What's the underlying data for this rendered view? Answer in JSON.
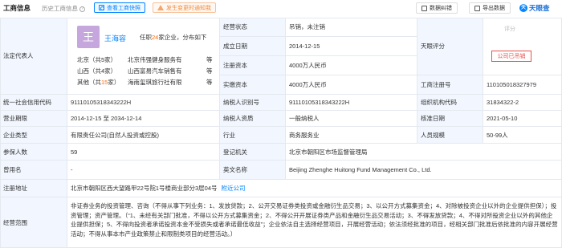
{
  "header": {
    "tab_main": "工商信息",
    "tab_history": "历史工商信息",
    "history_help": "?",
    "snapshot_btn": "查看工商快照",
    "alert_btn": "发生变更时通知我",
    "correct_btn": "数据纠错",
    "export_btn": "导出数据",
    "logo_mark": "天",
    "logo_text": "天眼查"
  },
  "legal_rep": {
    "label": "法定代表人",
    "avatar_char": "王",
    "name": "王海容",
    "note_prefix": "任职",
    "note_count": "24",
    "note_suffix": "家企业，分布如下",
    "rows": [
      {
        "region": "北京",
        "count_text": "（共5家）",
        "company": "北京伟强健身服务有",
        "etc": "等"
      },
      {
        "region": "山西",
        "count_text": "（共4家）",
        "company": "山西富易汽车销售有",
        "etc": "等"
      },
      {
        "region": "其他",
        "count_text_prefix": "（共",
        "count": "15",
        "count_text_suffix": "家）",
        "company": "海南玺琪旅行社有限",
        "etc": "等"
      }
    ]
  },
  "fields": {
    "status_label": "经营状态",
    "status_value": "吊销，未注销",
    "founded_label": "成立日期",
    "founded_value": "2014-12-15",
    "reg_capital_label": "注册资本",
    "reg_capital_value": "4000万人民币",
    "paid_capital_label": "实缴资本",
    "paid_capital_value": "4000万人民币",
    "rating_label": "天眼评分",
    "rating_top": "评分",
    "rating_box": "公司已吊销",
    "reg_no_label": "工商注册号",
    "reg_no_value": "110105018327979",
    "credit_code_label": "统一社会信用代码",
    "credit_code_value": "91110105318343222H",
    "taxpayer_id_label": "纳税人识别号",
    "taxpayer_id_value": "91110105318343222H",
    "org_code_label": "组织机构代码",
    "org_code_value": "31834322-2",
    "term_label": "营业期限",
    "term_value": "2014-12-15 至 2034-12-14",
    "taxpayer_q_label": "纳税人资质",
    "taxpayer_q_value": "一般纳税人",
    "approval_label": "核准日期",
    "approval_value": "2021-05-10",
    "type_label": "企业类型",
    "type_value": "有限责任公司(自然人投资或控股)",
    "industry_label": "行业",
    "industry_value": "商务服务业",
    "staff_size_label": "人员规模",
    "staff_size_value": "50-99人",
    "insured_label": "参保人数",
    "insured_value": "59",
    "authority_label": "登记机关",
    "authority_value": "北京市朝阳区市场监督管理局",
    "former_name_label": "曾用名",
    "former_name_value": "-",
    "english_label": "英文名称",
    "english_value": "Beijing Zhenghe Huitong Fund Management Co., Ltd.",
    "address_label": "注册地址",
    "address_value": "北京市朝阳区西大望路甲22号院1号楼商业部分3层04号",
    "address_link": "附近公司",
    "scope_label": "经营范围",
    "scope_value": "非证券业务的投资管理、咨询（不得从事下列业务：1、发放贷款；2、公开交易证券类投资或金融衍生品交易；3、以公开方式募集资金；4、对除被投资企业以外的企业提供担保）；投资管理；资产管理。（“1、未经有关部门批准，不得以公开方式募集资金；2、不得公开开展证券类产品和金融衍生品交易活动；3、不得发放贷款；4、不得对所投资企业以外的其他企业提供担保；5、不得向投资者承诺投资本金不受损失或者承诺最低收益”；企业依法自主选择经营项目，开展经营活动；依法须经批准的项目，经相关部门批准后依批准的内容开展经营活动；不得从事本市产业政策禁止和限制类项目的经营活动。）"
  }
}
